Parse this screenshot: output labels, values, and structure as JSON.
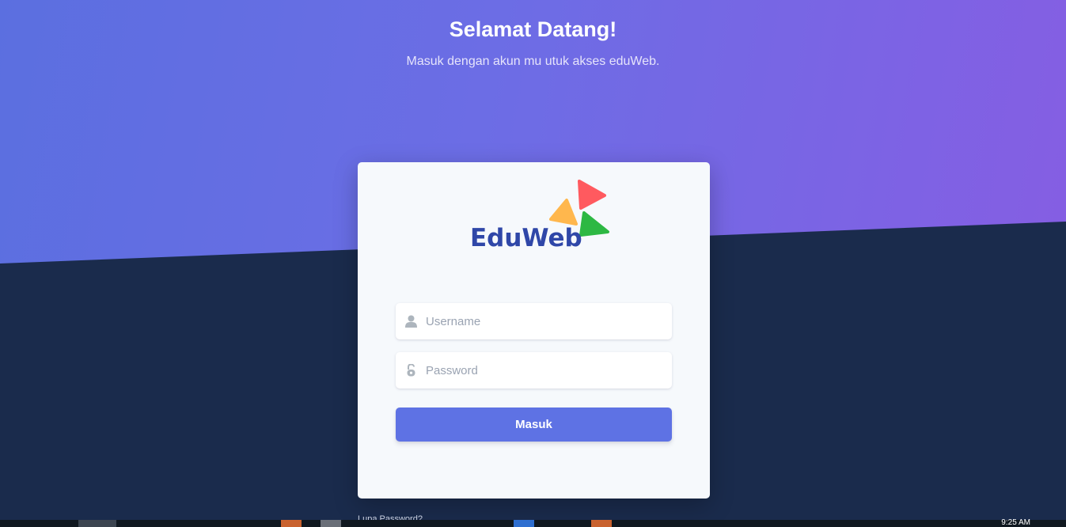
{
  "hero": {
    "title": "Selamat Datang!",
    "subtitle": "Masuk dengan akun mu utuk akses eduWeb."
  },
  "logo": {
    "text": "EduWeb"
  },
  "form": {
    "username_placeholder": "Username",
    "password_placeholder": "Password",
    "submit_label": "Masuk"
  },
  "footer": {
    "link_text": "Lupa Password?"
  },
  "taskbar": {
    "clock": "9:25 AM"
  },
  "colors": {
    "hero_gradient_start": "#5b6fe0",
    "hero_gradient_end": "#855ee3",
    "page_background": "#1a2b4c",
    "button": "#5e72e4",
    "card": "#f6f9fc"
  },
  "icons": {
    "username": "user-icon",
    "password": "lock-icon"
  }
}
